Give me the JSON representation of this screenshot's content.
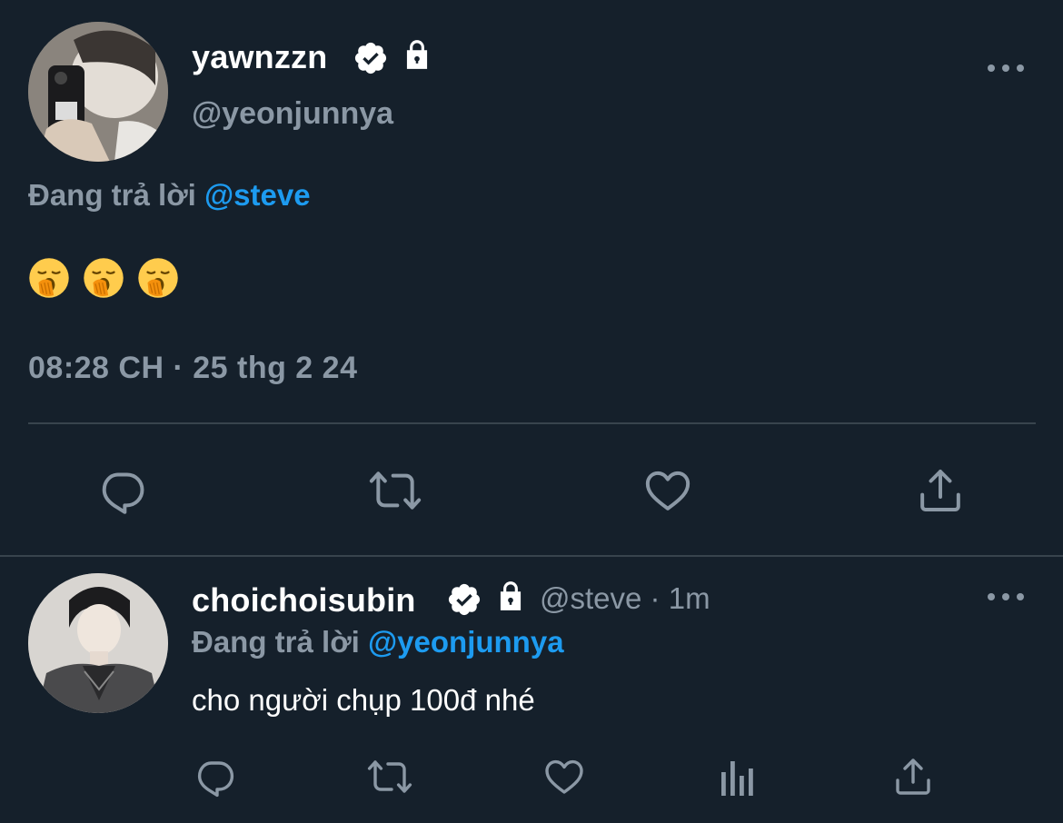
{
  "main_tweet": {
    "display_name": "yawnzzn",
    "handle": "@yeonjunnya",
    "replying_prefix": "Đang trả lời",
    "replying_to": "@steve",
    "content_emoji": [
      "yawning-face-emoji",
      "yawning-face-emoji",
      "yawning-face-emoji"
    ],
    "timestamp": "08:28 CH · 25 thg 2 24",
    "icons": {
      "verified": "verified-badge-icon",
      "protected": "lock-icon",
      "more": "more-options-icon"
    },
    "actions": [
      "reply-icon",
      "retweet-icon",
      "like-icon",
      "share-icon"
    ]
  },
  "reply_tweet": {
    "display_name": "choichoisubin",
    "handle": "@steve",
    "separator": "·",
    "time_ago": "1m",
    "replying_prefix": "Đang trả lời",
    "replying_to": "@yeonjunnya",
    "text": "cho người chụp 100đ nhé",
    "icons": {
      "verified": "verified-badge-icon",
      "protected": "lock-icon",
      "more": "more-options-icon"
    },
    "actions": [
      "reply-icon",
      "retweet-icon",
      "like-icon",
      "views-icon",
      "share-icon"
    ]
  },
  "colors": {
    "background": "#15202b",
    "divider": "#38444d",
    "secondary_text": "#8b98a5",
    "accent": "#1d9bf0",
    "primary_text": "#ffffff"
  }
}
